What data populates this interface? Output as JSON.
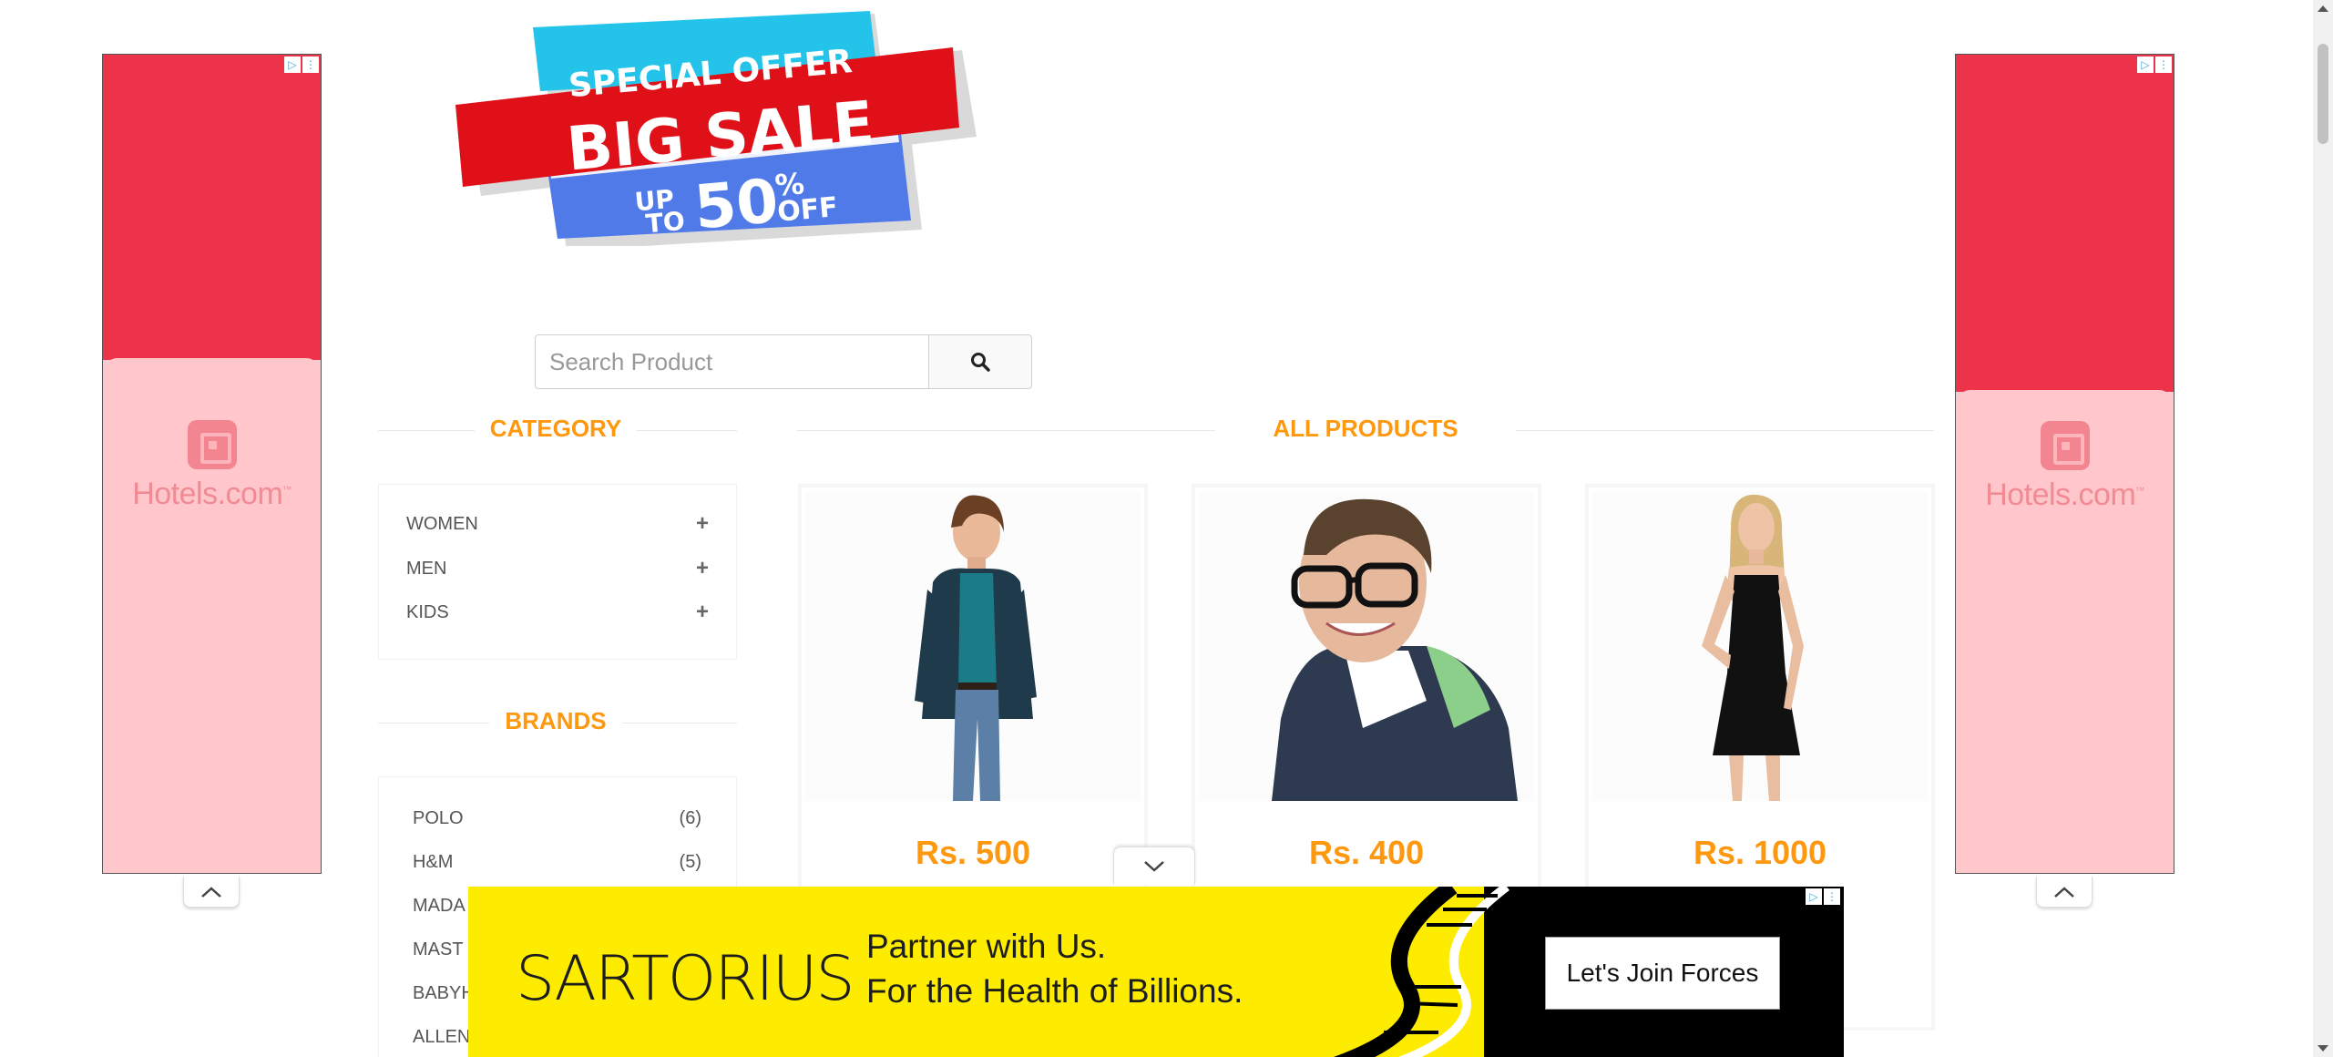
{
  "banner": {
    "line1": "SPECIAL OFFER",
    "line2": "BIG SALE",
    "line3_up": "UP",
    "line3_to": "TO",
    "line3_num": "50",
    "line3_pct": "%",
    "line3_off": "OFF"
  },
  "search": {
    "placeholder": "Search Product",
    "icon": "search-icon"
  },
  "category": {
    "title": "CATEGORY",
    "items": [
      {
        "label": "WOMEN",
        "icon": "plus-icon"
      },
      {
        "label": "MEN",
        "icon": "plus-icon"
      },
      {
        "label": "KIDS",
        "icon": "plus-icon"
      }
    ]
  },
  "brands": {
    "title": "BRANDS",
    "items": [
      {
        "label": "POLO",
        "count": "(6)"
      },
      {
        "label": "H&M",
        "count": "(5)"
      },
      {
        "label": "MADA",
        "count": ""
      },
      {
        "label": "MAST",
        "count": ""
      },
      {
        "label": "BABYH",
        "count": ""
      },
      {
        "label": "ALLEN",
        "count": ""
      }
    ]
  },
  "products": {
    "title": "ALL PRODUCTS",
    "items": [
      {
        "price": "Rs. 500"
      },
      {
        "price": "Rs. 400"
      },
      {
        "price": "Rs. 1000"
      }
    ]
  },
  "side_ad": {
    "brand": "Hotels.com",
    "tm": "™",
    "adchoice_play": "▷",
    "adchoice_more": "⋮"
  },
  "bottom_ad": {
    "brand": "SARTORIUS",
    "line1": "Partner with Us.",
    "line2": "For the Health of Billions.",
    "cta": "Let's Join Forces"
  },
  "colors": {
    "accent": "#fe980f",
    "ad_red": "#ec3349",
    "ad_pink": "#ffc6cb",
    "ad_yellow": "#fdec00"
  }
}
